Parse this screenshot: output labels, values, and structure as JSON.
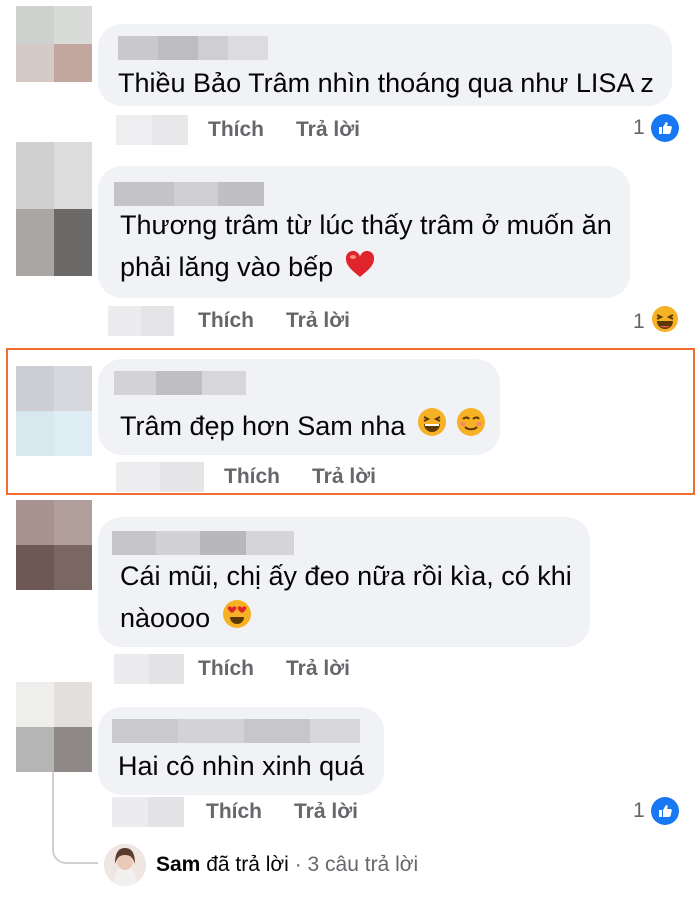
{
  "comments": [
    {
      "text": "Thiều Bảo Trâm nhìn thoáng qua như LISA z",
      "like_label": "Thích",
      "reply_label": "Trả lời",
      "reaction_count": "1",
      "reaction_icon": "like-icon"
    },
    {
      "text_line1": "Thương trâm từ lúc thấy trâm ở muốn ăn",
      "text_line2": "phải lăng vào bếp",
      "emoji": "heart-icon",
      "like_label": "Thích",
      "reply_label": "Trả lời",
      "reaction_count": "1",
      "reaction_icon": "laughing-icon"
    },
    {
      "text": "Trâm đẹp hơn Sam nha",
      "emojis": [
        "grinning-squint-icon",
        "smiling-blush-icon"
      ],
      "like_label": "Thích",
      "reply_label": "Trả lời",
      "highlighted": true
    },
    {
      "text_line1": "Cái mũi, chị ấy đeo nữa rồi kìa, có khi",
      "text_line2": "nàoooo",
      "emoji": "heart-eyes-icon",
      "like_label": "Thích",
      "reply_label": "Trả lời"
    },
    {
      "text": "Hai cô nhìn xinh quá",
      "like_label": "Thích",
      "reply_label": "Trả lời",
      "reaction_count": "1",
      "reaction_icon": "like-icon"
    }
  ],
  "reply_summary": {
    "author": "Sam",
    "action": "đã trả lời",
    "separator": "·",
    "count_text": "3 câu trả lời"
  },
  "colors": {
    "bubble": "#f0f2f5",
    "action_text": "#65676b",
    "like_blue": "#1877f2",
    "highlight_border": "#f26b2f"
  }
}
